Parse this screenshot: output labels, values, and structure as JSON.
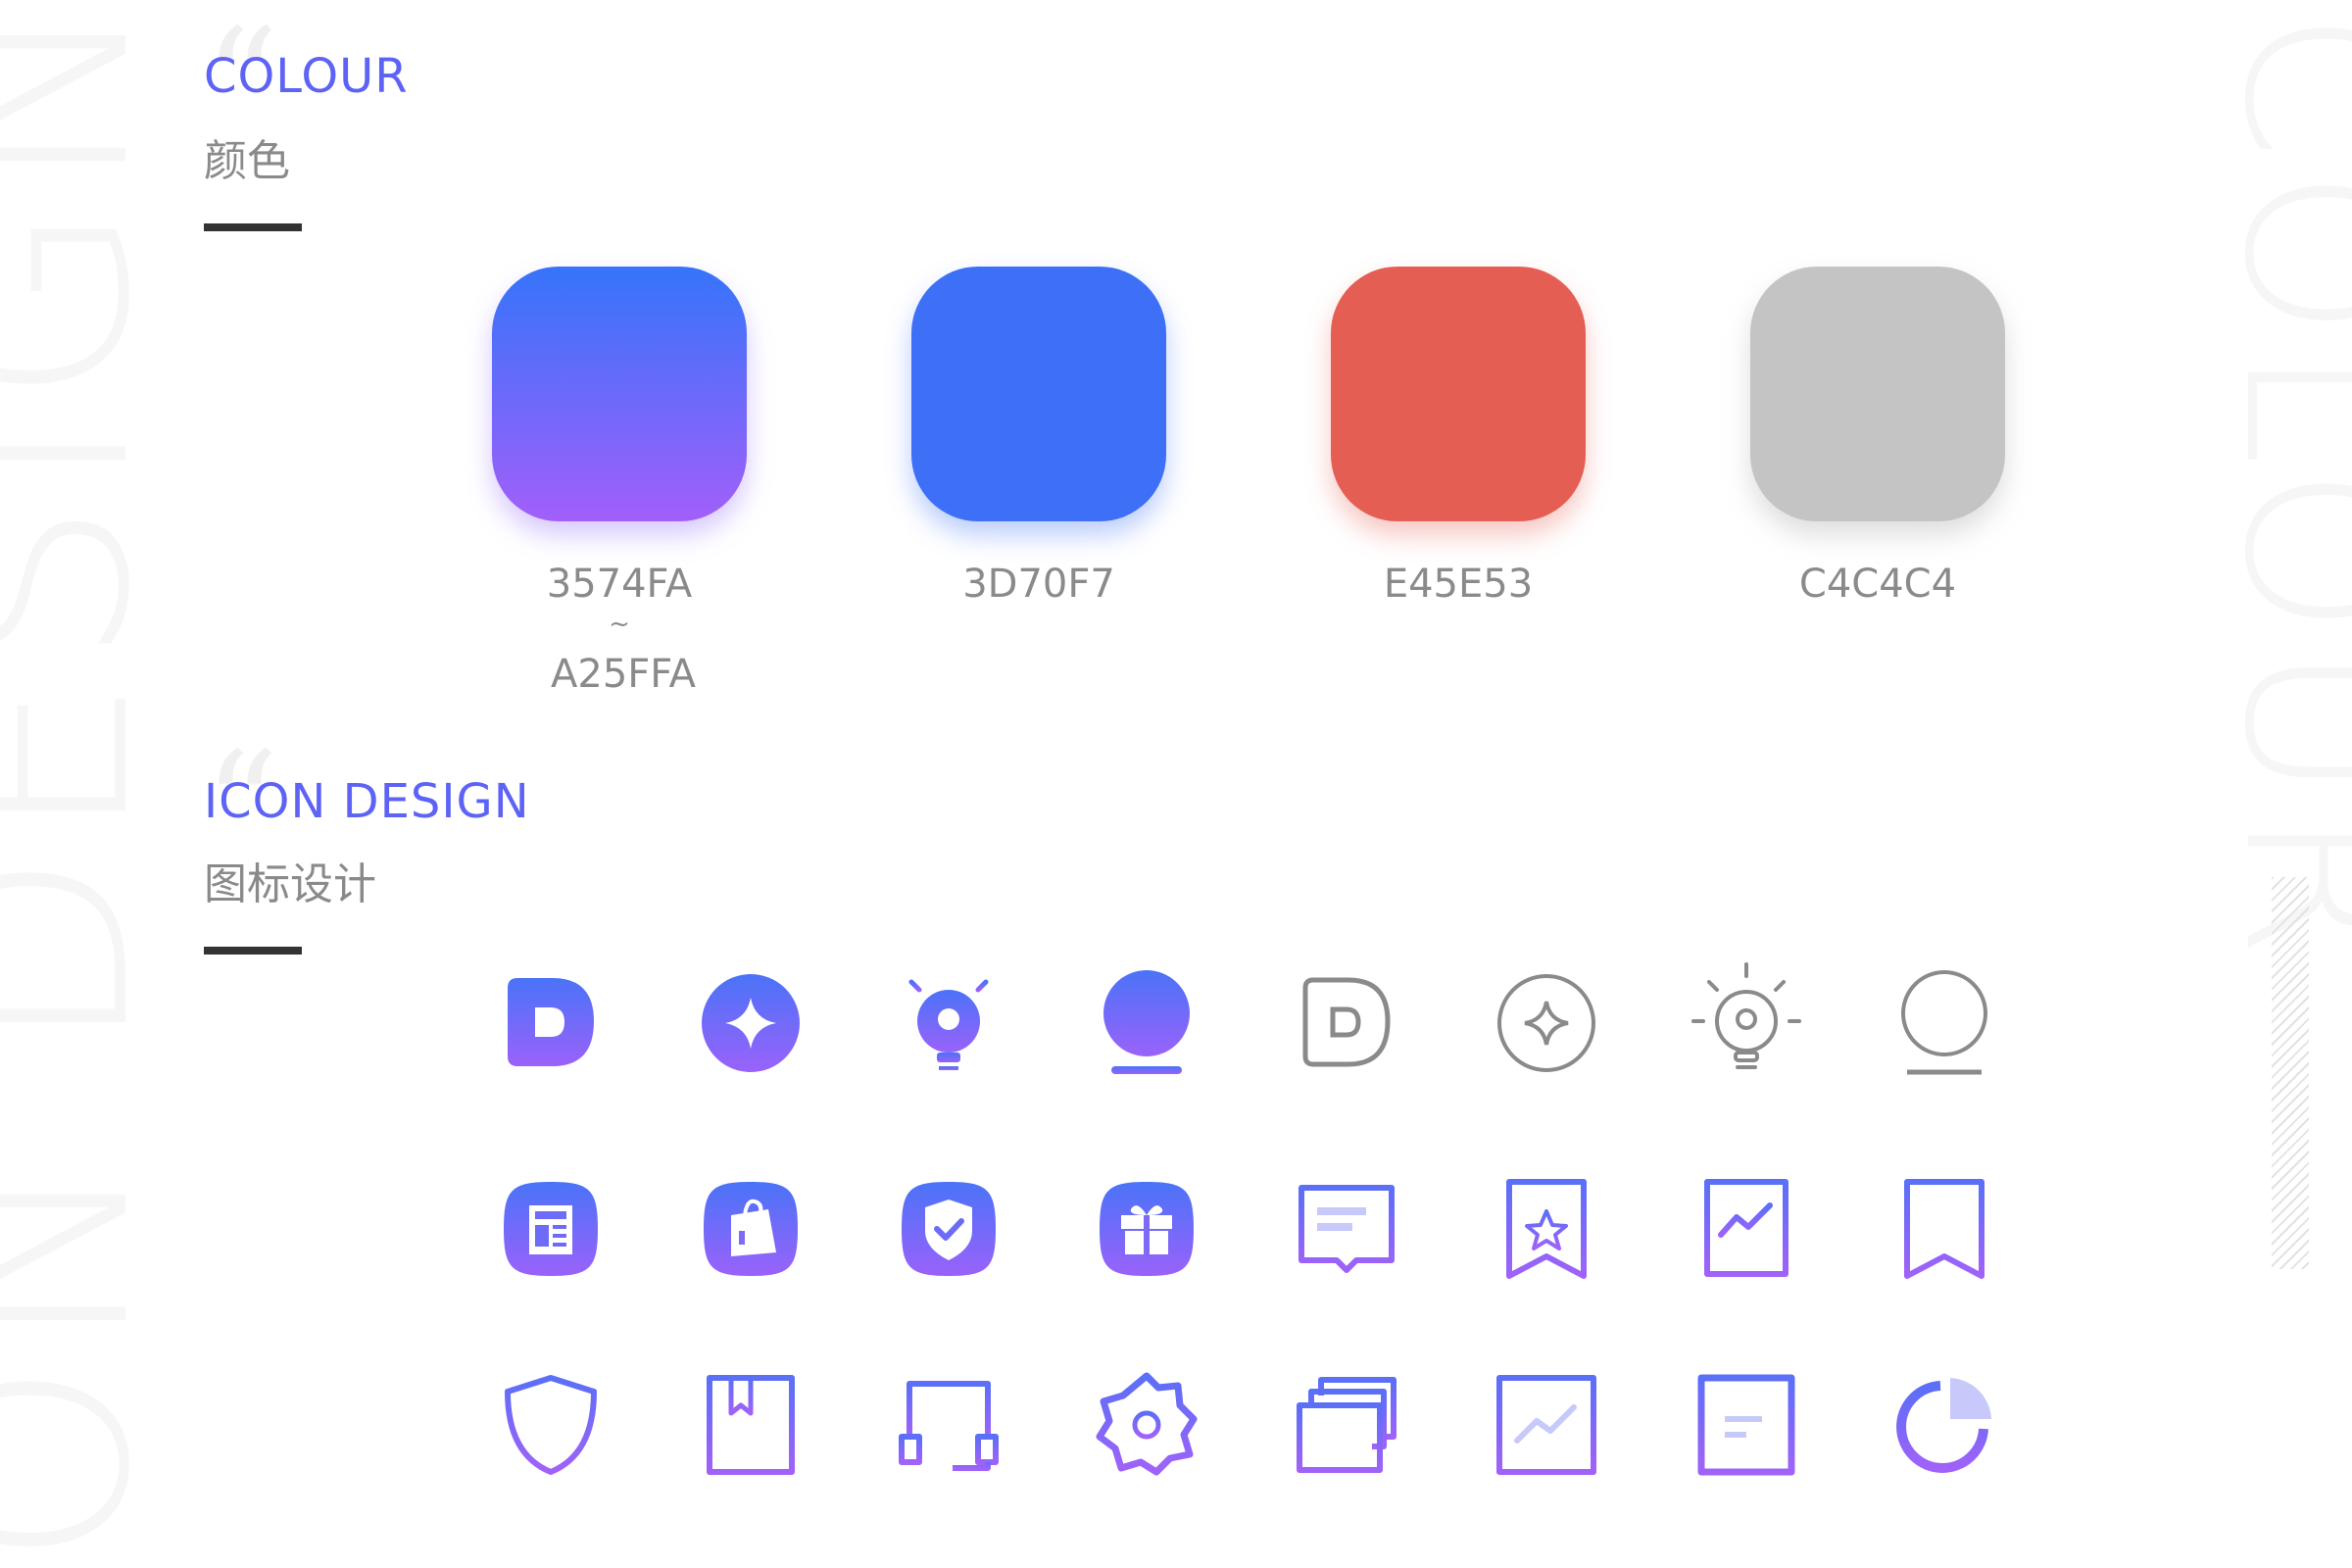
{
  "background": {
    "left_text": "ON DESIGN",
    "right_text": "COLOUR"
  },
  "colour_section": {
    "title": "COLOUR",
    "subtitle": "颜色",
    "swatches": [
      {
        "label": "3574FA",
        "label2": "A25FFA",
        "separator": "~",
        "colors": [
          "#3574FA",
          "#A25FFA"
        ]
      },
      {
        "label": "3D70F7",
        "colors": [
          "#3D70F7"
        ]
      },
      {
        "label": "E45E53",
        "colors": [
          "#E45E53"
        ]
      },
      {
        "label": "C4C4C4",
        "colors": [
          "#C4C4C4"
        ]
      }
    ]
  },
  "icon_section": {
    "title": "ICON DESIGN",
    "subtitle": "图标设计",
    "rows": [
      [
        "d-logo-filled-icon",
        "sparkle-filled-icon",
        "lightbulb-filled-icon",
        "circle-base-filled-icon",
        "d-logo-outline-icon",
        "sparkle-outline-icon",
        "lightbulb-outline-icon",
        "circle-base-outline-icon"
      ],
      [
        "receipt-icon",
        "shopping-bag-icon",
        "shield-check-icon",
        "gift-icon",
        "message-icon",
        "bookmark-star-icon",
        "chart-book-icon",
        "bookmark-add-icon"
      ],
      [
        "shield-plus-icon",
        "book-icon",
        "headphones-icon",
        "settings-gear-icon",
        "cards-stack-icon",
        "line-chart-icon",
        "document-icon",
        "pie-chart-icon"
      ]
    ]
  },
  "colors": {
    "accent": "#5D63F5",
    "gradient_start": "#3574FA",
    "gradient_end": "#A25FFA",
    "gray_outline": "#8A8A8A",
    "text_gray": "#8A8A8A",
    "rule": "#333333"
  }
}
